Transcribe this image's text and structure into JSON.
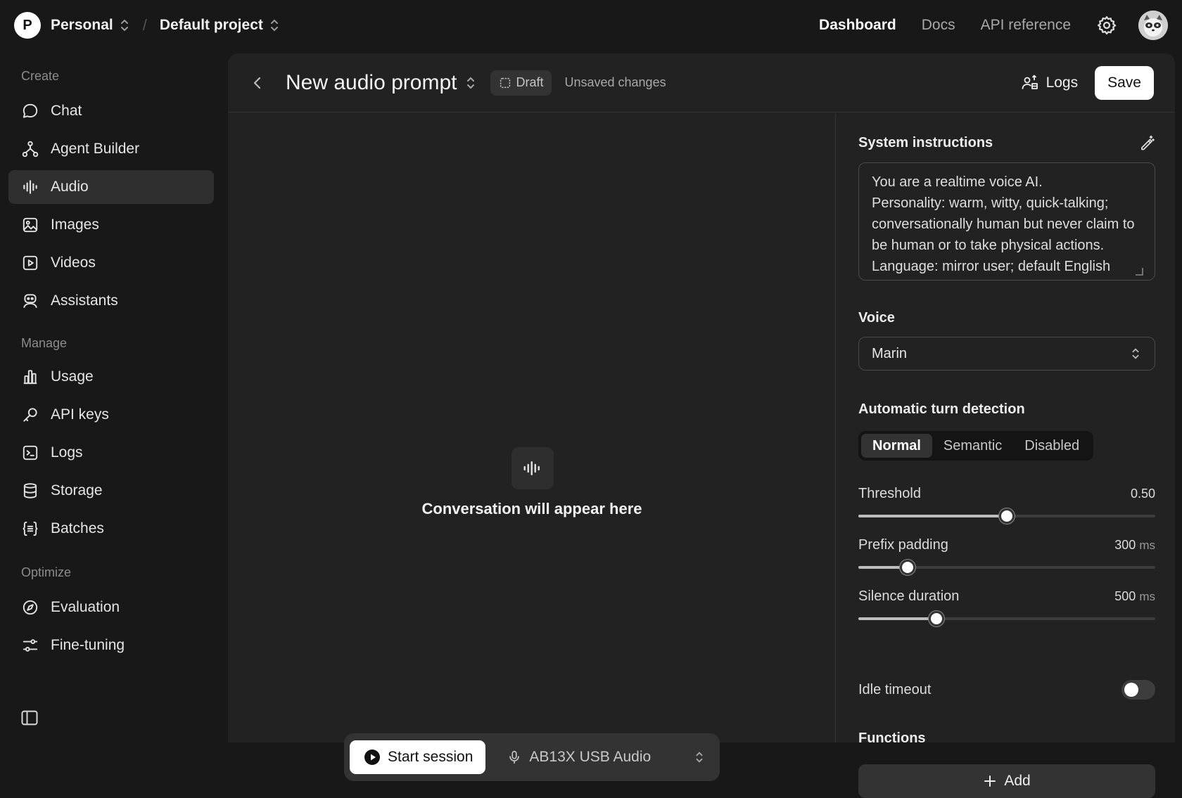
{
  "topbar": {
    "org_initial": "P",
    "org_name": "Personal",
    "project_name": "Default project",
    "nav": [
      {
        "label": "Dashboard",
        "active": true
      },
      {
        "label": "Docs",
        "active": false
      },
      {
        "label": "API reference",
        "active": false
      }
    ],
    "settings_icon": "gear-icon",
    "avatar_icon": "user-avatar"
  },
  "sidebar": {
    "sections": [
      {
        "title": "Create",
        "items": [
          {
            "label": "Chat",
            "icon": "chat-icon"
          },
          {
            "label": "Agent Builder",
            "icon": "agent-builder-icon"
          },
          {
            "label": "Audio",
            "icon": "audio-waveform-icon",
            "active": true
          },
          {
            "label": "Images",
            "icon": "image-icon"
          },
          {
            "label": "Videos",
            "icon": "video-icon"
          },
          {
            "label": "Assistants",
            "icon": "assistant-icon"
          }
        ]
      },
      {
        "title": "Manage",
        "items": [
          {
            "label": "Usage",
            "icon": "bar-chart-icon"
          },
          {
            "label": "API keys",
            "icon": "key-icon"
          },
          {
            "label": "Logs",
            "icon": "terminal-icon"
          },
          {
            "label": "Storage",
            "icon": "database-icon"
          },
          {
            "label": "Batches",
            "icon": "braces-icon"
          }
        ]
      },
      {
        "title": "Optimize",
        "items": [
          {
            "label": "Evaluation",
            "icon": "compass-icon"
          },
          {
            "label": "Fine-tuning",
            "icon": "sliders-icon"
          }
        ]
      }
    ],
    "collapse_icon": "sidebar-toggle-icon"
  },
  "header": {
    "title": "New audio prompt",
    "draft_label": "Draft",
    "unsaved_label": "Unsaved changes",
    "logs_label": "Logs",
    "save_label": "Save"
  },
  "conversation": {
    "empty_text": "Conversation will appear here",
    "start_label": "Start session",
    "mic_device": "AB13X USB Audio"
  },
  "settings": {
    "system_instructions_label": "System instructions",
    "system_instructions": "You are a realtime voice AI.\nPersonality: warm, witty, quick-talking; conversationally human but never claim to be human or to take physical actions.\nLanguage: mirror user; default English",
    "voice_label": "Voice",
    "voice_value": "Marin",
    "turn_detection_label": "Automatic turn detection",
    "turn_detection_options": [
      "Normal",
      "Semantic",
      "Disabled"
    ],
    "turn_detection_selected": "Normal",
    "threshold": {
      "label": "Threshold",
      "display": "0.50",
      "fraction": 0.5
    },
    "prefix_padding": {
      "label": "Prefix padding",
      "display": "300",
      "unit": "ms",
      "fraction": 0.167
    },
    "silence_duration": {
      "label": "Silence duration",
      "display": "500",
      "unit": "ms",
      "fraction": 0.262
    },
    "idle_timeout_label": "Idle timeout",
    "idle_timeout_on": false,
    "functions_label": "Functions",
    "add_label": "Add"
  }
}
